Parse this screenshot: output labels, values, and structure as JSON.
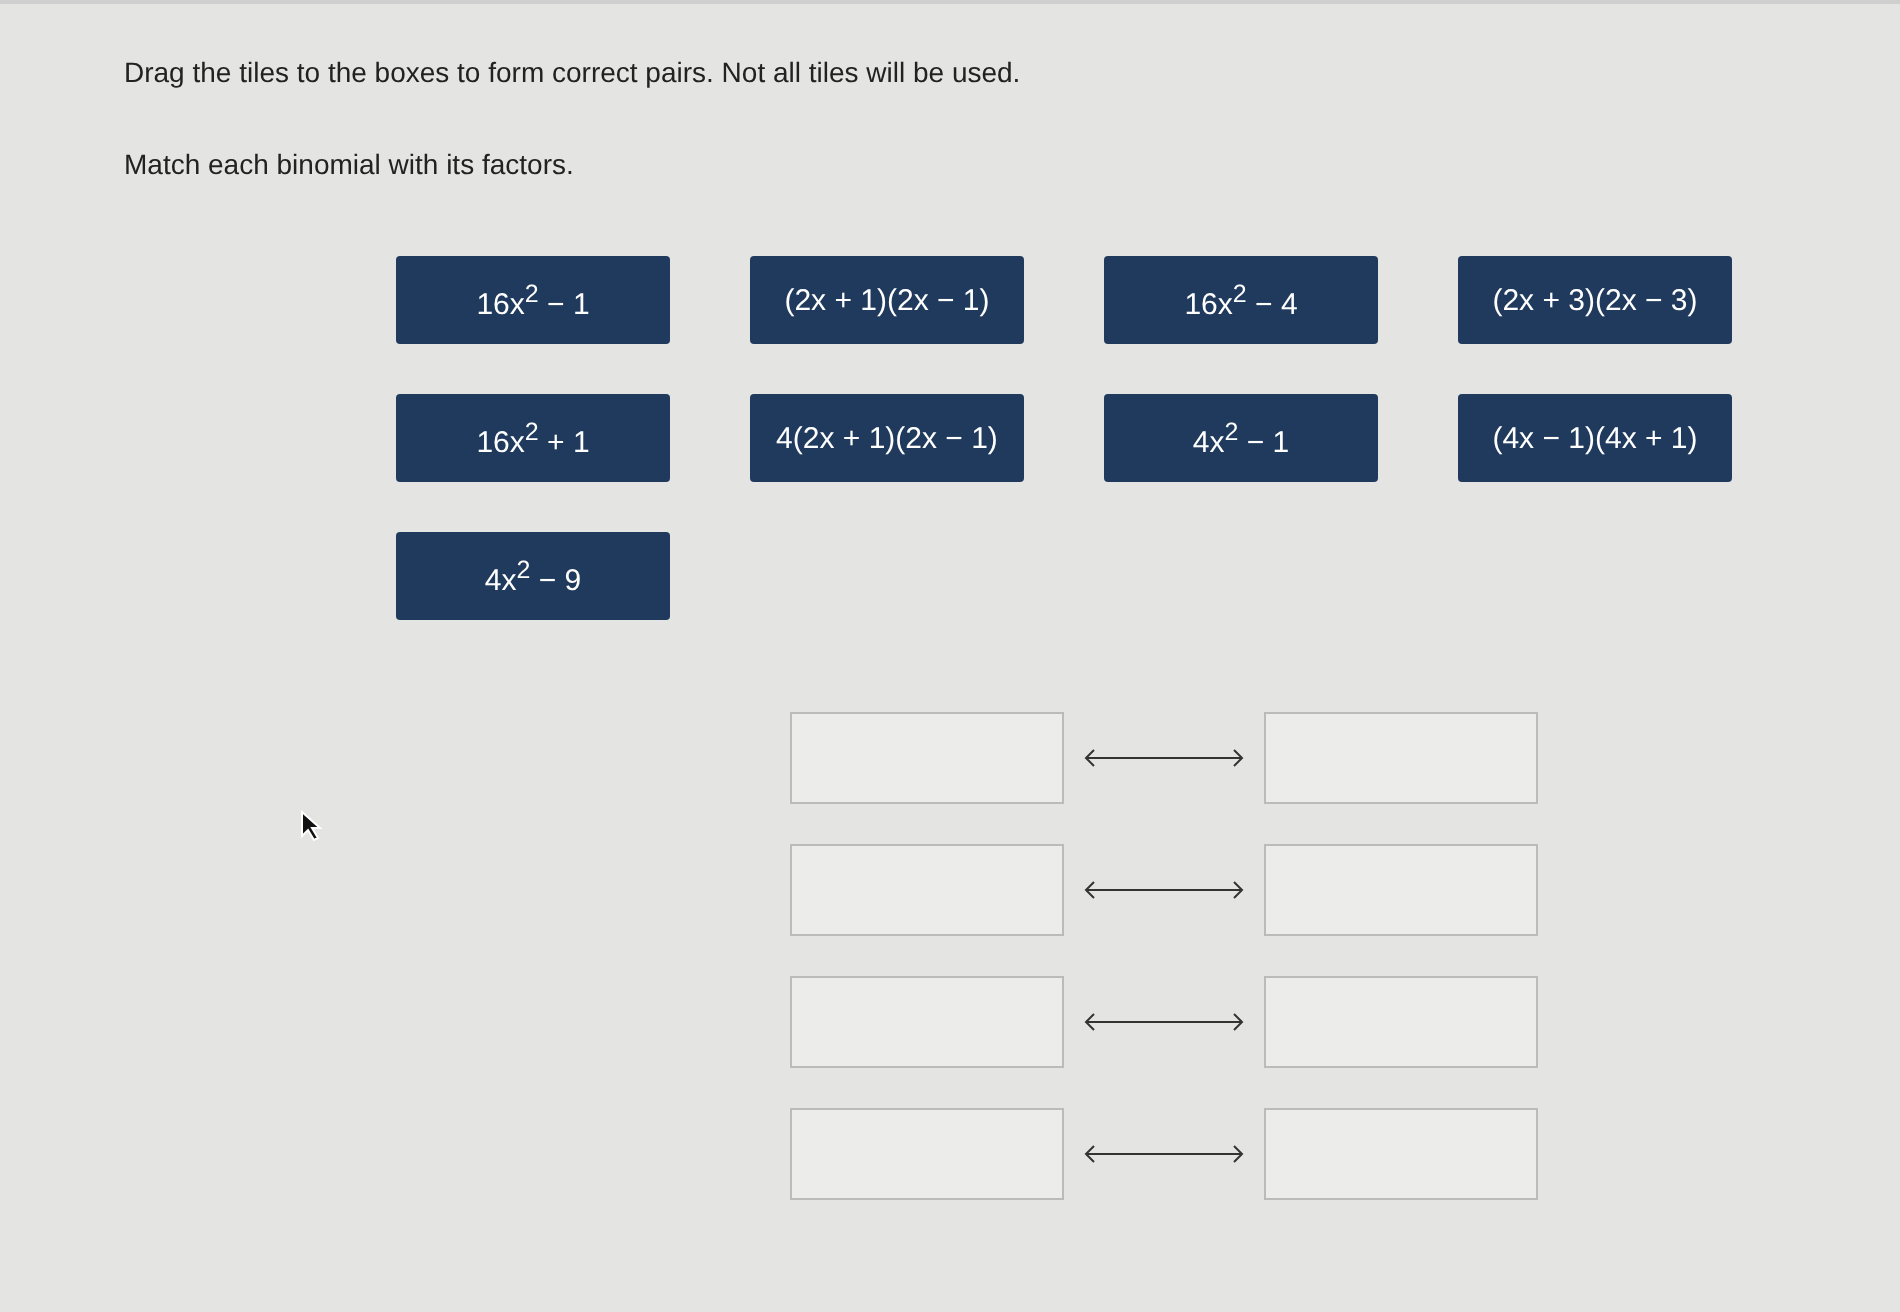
{
  "instructions": "Drag the tiles to the boxes to form correct pairs. Not all tiles will be used.",
  "prompt": "Match each binomial with its factors.",
  "tiles": [
    "16x$^{2}$ − 1",
    "(2x + 1)(2x − 1)",
    "16x$^{2}$ − 4",
    "(2x + 3)(2x − 3)",
    "16x$^{2}$ + 1",
    "4(2x + 1)(2x − 1)",
    "4x$^{2}$ − 1",
    "(4x − 1)(4x + 1)",
    "4x$^{2}$ − 9"
  ],
  "match_rows": [
    {
      "left": {
        "empty": true
      },
      "right": {
        "empty": true
      }
    },
    {
      "left": {
        "empty": true
      },
      "right": {
        "empty": true
      }
    },
    {
      "left": {
        "empty": true
      },
      "right": {
        "empty": true
      }
    },
    {
      "left": {
        "empty": true
      },
      "right": {
        "empty": true
      }
    }
  ]
}
